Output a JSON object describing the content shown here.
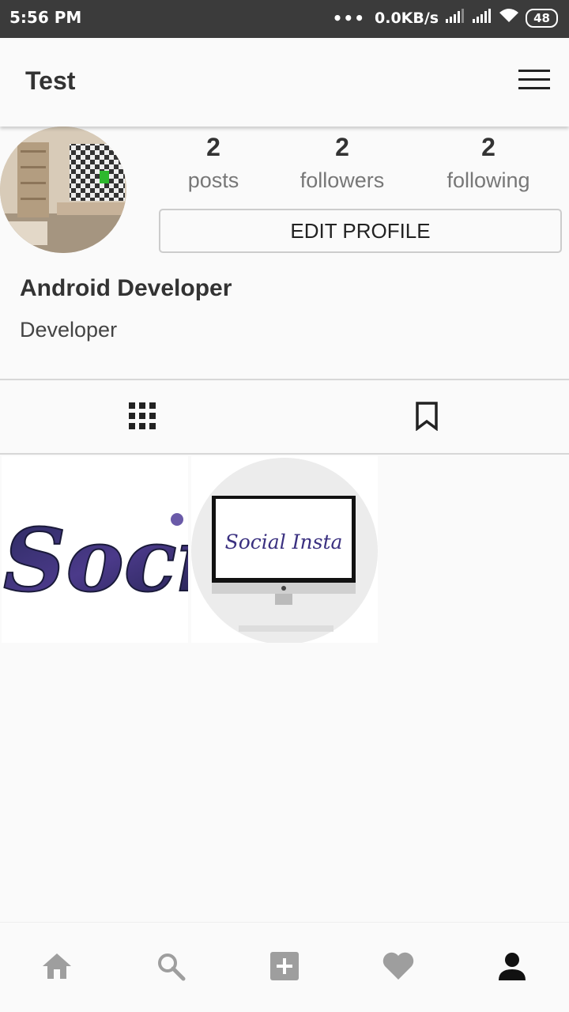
{
  "status_bar": {
    "time": "5:56 PM",
    "dots": "•••",
    "net_speed": "0.0KB/s",
    "battery": "48",
    "icons": [
      "signal-icon",
      "signal-icon",
      "wifi-icon",
      "battery-icon"
    ]
  },
  "app_bar": {
    "title": "Test",
    "menu_icon": "hamburger-menu-icon"
  },
  "profile": {
    "stats": [
      {
        "value": "2",
        "label": "posts"
      },
      {
        "value": "2",
        "label": "followers"
      },
      {
        "value": "2",
        "label": "following"
      }
    ],
    "edit_button": "EDIT PROFILE",
    "display_name": "Android Developer",
    "bio": "Developer"
  },
  "tabs": [
    {
      "icon": "grid-icon"
    },
    {
      "icon": "bookmark-icon"
    }
  ],
  "posts": [
    {
      "image_text": "Soci"
    },
    {
      "image_text": "Social Insta"
    }
  ],
  "bottom_nav": [
    {
      "icon": "home-icon"
    },
    {
      "icon": "search-icon"
    },
    {
      "icon": "add-post-icon"
    },
    {
      "icon": "heart-icon"
    },
    {
      "icon": "profile-icon"
    }
  ],
  "colors": {
    "status_bar": "#3b3b3b",
    "background": "#fafafa",
    "inactive_icon": "#9e9e9e",
    "active_icon": "#111111",
    "text": "#333333"
  }
}
